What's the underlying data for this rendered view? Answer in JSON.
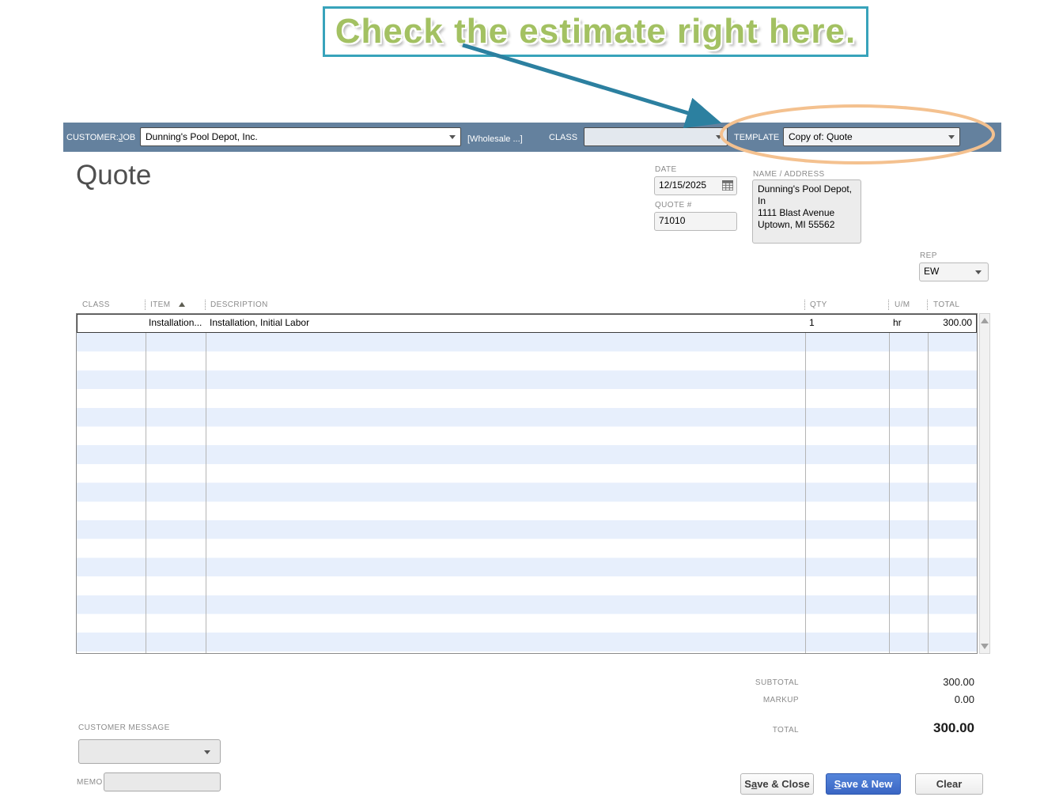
{
  "callout": {
    "text": "Check the estimate right here."
  },
  "topbar": {
    "customer_job_label_pre": "CUSTOMER:",
    "customer_job_label_mnemonic": "J",
    "customer_job_label_post": "OB",
    "customer_job_value": "Dunning's Pool Depot, Inc.",
    "wholesale_text": "[Wholesale ...]",
    "class_label": "CLASS",
    "class_value": "",
    "template_label": "TEMPLATE",
    "template_value": "Copy of: Quote"
  },
  "form": {
    "title": "Quote",
    "date_label": "DATE",
    "date_value": "12/15/2025",
    "quote_number_label": "QUOTE #",
    "quote_number_value": "71010",
    "name_address_label": "NAME / ADDRESS",
    "name_address_lines": [
      "Dunning's Pool Depot, In",
      "1111 Blast Avenue",
      "Uptown, MI 55562"
    ],
    "rep_label": "REP",
    "rep_value": "EW"
  },
  "table": {
    "columns": {
      "class": "CLASS",
      "item": "ITEM",
      "description": "DESCRIPTION",
      "qty": "QTY",
      "um": "U/M",
      "total": "TOTAL"
    },
    "rows": [
      {
        "class": "",
        "item": "Installation...",
        "description": "Installation, Initial Labor",
        "qty": "1",
        "um": "hr",
        "total": "300.00"
      }
    ]
  },
  "totals": {
    "subtotal_label": "SUBTOTAL",
    "subtotal_value": "300.00",
    "markup_label": "MARKUP",
    "markup_value": "0.00",
    "total_label": "TOTAL",
    "total_value": "300.00"
  },
  "footer": {
    "customer_message_label": "CUSTOMER MESSAGE",
    "customer_message_value": "",
    "memo_label": "MEMO",
    "memo_value": "",
    "save_close_pre": "S",
    "save_close_mnemonic": "a",
    "save_close_post": "ve & Close",
    "save_new_pre": "",
    "save_new_mnemonic": "S",
    "save_new_post": "ave & New",
    "clear_label": "Clear"
  },
  "colors": {
    "topbar_bg": "#64819e",
    "accent_teal": "#2c80a0",
    "callout_border_teal": "#38a3bb",
    "callout_green": "#a3c162",
    "annotation_orange": "#f4c18f",
    "stripe_blue": "#e7effc",
    "primary_button_blue": "#3a66c4"
  }
}
